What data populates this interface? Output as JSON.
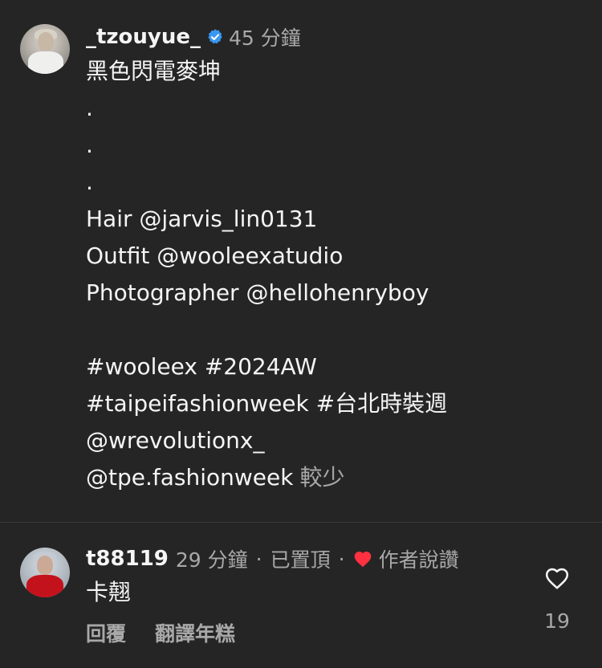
{
  "post": {
    "username": "_tzouyue_",
    "timestamp": "45 分鐘",
    "caption_lines": [
      "黑色閃電麥坤",
      ".",
      ".",
      ".",
      "Hair  @jarvis_lin0131",
      "Outfit  @wooleexatudio",
      "Photographer  @hellohenryboy",
      "",
      "#wooleex  #2024AW",
      "#taipeifashionweek  #台北時裝週",
      "@wrevolutionx_",
      "@tpe.fashionweek"
    ],
    "less_label": "較少"
  },
  "reply": {
    "username": "t88119",
    "timestamp": "29 分鐘",
    "separator": "·",
    "pinned_label": "已置頂",
    "author_liked_label": "作者說讚",
    "text": "卡翹",
    "reply_label": "回覆",
    "translate_label": "翻譯年糕",
    "like_count": "19"
  },
  "colors": {
    "background": "#252525",
    "text": "#f5f5f5",
    "muted": "#a8a8a8",
    "verified": "#3897f0",
    "heart": "#ff3040"
  },
  "icons": {
    "verified": "verified-badge-icon",
    "author_heart": "heart-filled-icon",
    "like": "heart-outline-icon"
  }
}
